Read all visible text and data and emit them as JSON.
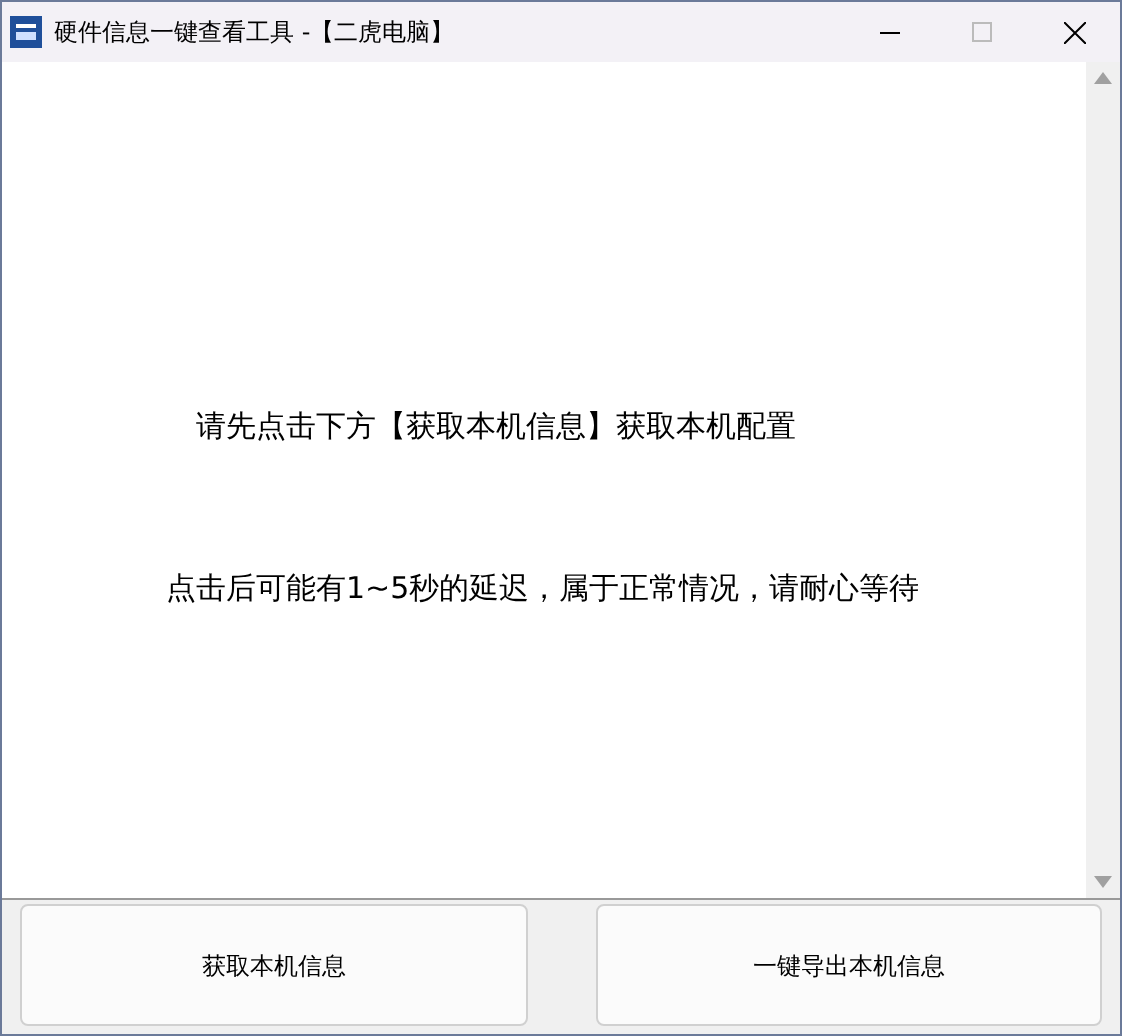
{
  "window": {
    "title": "硬件信息一键查看工具 -【二虎电脑】"
  },
  "content": {
    "lines": [
      "请先点击下方【获取本机信息】获取本机配置",
      "点击后可能有1~5秒的延迟，属于正常情况，请耐心等待"
    ]
  },
  "buttons": [
    "获取本机信息",
    "一键导出本机信息"
  ]
}
